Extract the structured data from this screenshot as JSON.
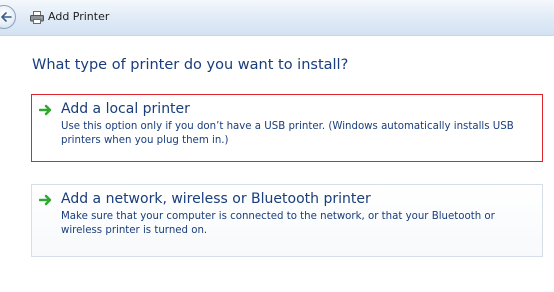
{
  "window": {
    "title": "Add Printer"
  },
  "icons": {
    "back": "back-arrow-icon",
    "printer": "printer-icon",
    "option_arrow": "green-arrow-icon"
  },
  "colors": {
    "accent_text": "#1a3d7c",
    "selection_border": "#e0262b",
    "arrow_green": "#2ea82e"
  },
  "main": {
    "heading": "What type of printer do you want to install?",
    "options": [
      {
        "title": "Add a local printer",
        "description": "Use this option only if you don’t have a USB printer. (Windows automatically installs USB printers when you plug them in.)",
        "selected": true
      },
      {
        "title": "Add a network, wireless or Bluetooth printer",
        "description": "Make sure that your computer is connected to the network, or that your Bluetooth or wireless printer is turned on.",
        "selected": false
      }
    ]
  }
}
